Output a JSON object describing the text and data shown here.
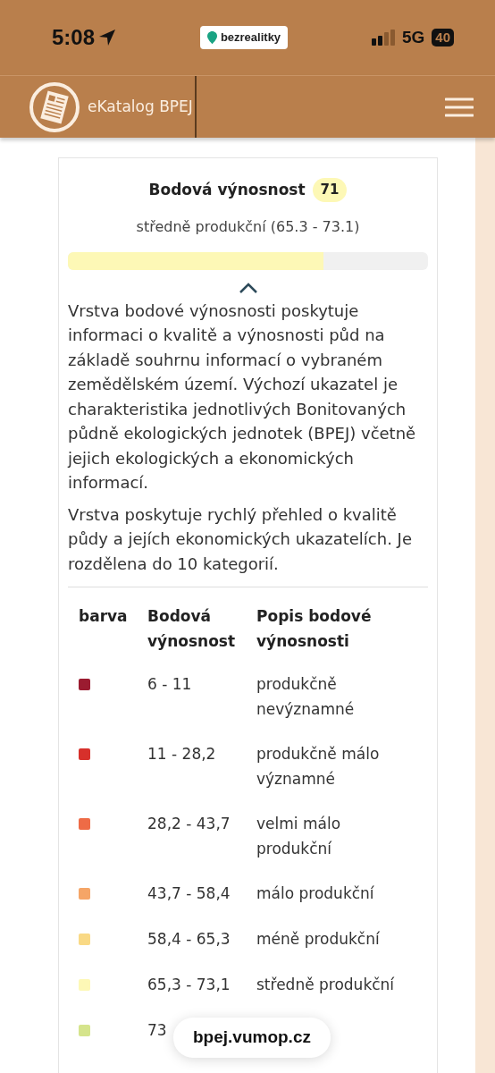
{
  "status_bar": {
    "time": "5:08",
    "app_badge": "bezrealitky",
    "network": "5G",
    "battery": "40"
  },
  "navbar": {
    "title": "eKatalog BPEJ"
  },
  "score": {
    "title": "Bodová výnosnost",
    "value": "71",
    "category": "středně produkční (65.3 - 73.1)",
    "level": 0.71,
    "expanded": true
  },
  "description": [
    "Vrstva bodové výnosnosti poskytuje informaci o kvalitě a výnosnosti půd na základě souhrnu informací o vybraném zemědělském území. Výchozí ukazatel je charakteristika jednotlivých Bonitovaných půdně ekologických jednotek (BPEJ) včetně jejich ekologických a ekonomických informací.",
    "Vrstva poskytuje rychlý přehled o kvalitě půdy a jejích ekonomických ukazatelích. Je rozdělena do 10 kategorií."
  ],
  "table": {
    "columns": [
      "barva",
      "Bodová výnosnost",
      "Popis bodové výnosnosti"
    ],
    "rows": [
      {
        "color": "#9b1b30",
        "range": "6 - 11",
        "description": "produkčně nevýznamné"
      },
      {
        "color": "#d7302b",
        "range": "11 - 28,2",
        "description": "produkčně málo významné"
      },
      {
        "color": "#ee6b46",
        "range": "28,2 - 43,7",
        "description": "velmi málo produkční"
      },
      {
        "color": "#f5a567",
        "range": "43,7 - 58,4",
        "description": "málo produkční"
      },
      {
        "color": "#f9d985",
        "range": "58,4 - 65,3",
        "description": "méně produkční"
      },
      {
        "color": "#fdf8b6",
        "range": "65,3 - 73,1",
        "description": "středně produkční"
      },
      {
        "color": "#d5e48c",
        "range": "73"
      }
    ]
  },
  "url_pill": "bpej.vumop.cz"
}
